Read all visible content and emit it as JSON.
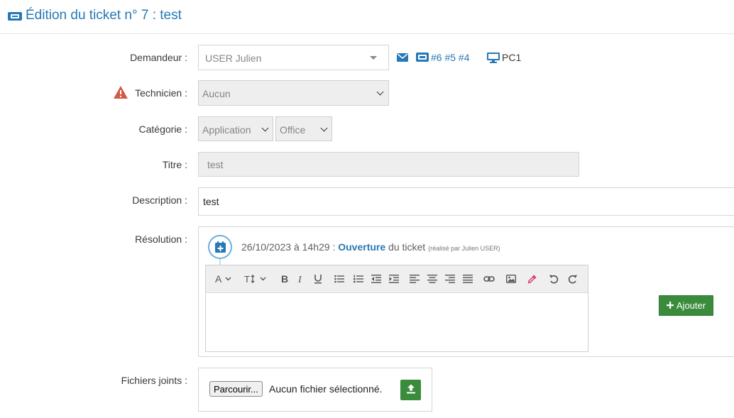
{
  "header": {
    "title": "Édition du ticket n° 7 : test",
    "icon": "ticket-icon"
  },
  "form": {
    "demandeur": {
      "label": "Demandeur :",
      "value": "USER Julien"
    },
    "links": {
      "tickets": "#6 #5 #4",
      "asset": "PC1"
    },
    "technicien": {
      "label": "Technicien :",
      "value": "Aucun"
    },
    "categorie": {
      "label": "Catégorie :",
      "value": "Application",
      "subvalue": "Office"
    },
    "titre": {
      "label": "Titre :",
      "value": "test"
    },
    "description": {
      "label": "Description :",
      "value": "test"
    },
    "resolution": {
      "label": "Résolution :",
      "event": {
        "date": "26/10/2023 à 14h29 :",
        "action": "Ouverture",
        "suffix": "du ticket",
        "by": "(réalisé par Julien USER)"
      },
      "add_label": "Ajouter"
    },
    "fichiers": {
      "label": "Fichiers joints :",
      "browse_label": "Parcourir...",
      "none_label": "Aucun fichier sélectionné."
    }
  },
  "colors": {
    "accent": "#2679b5",
    "success": "#3a8b3b",
    "warning": "#d15b47"
  }
}
